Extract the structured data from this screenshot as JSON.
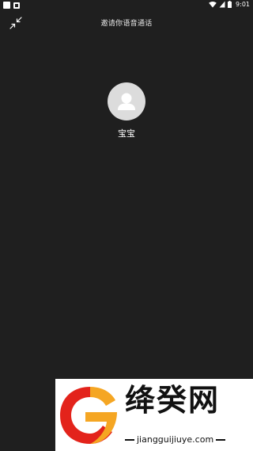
{
  "status_bar": {
    "time": "9:01",
    "icons": [
      "notification-square-icon",
      "app-notification-icon",
      "wifi-icon",
      "no-sim-icon",
      "battery-icon"
    ]
  },
  "call": {
    "title": "邀请你语音通话",
    "contact_name": "宝宝"
  },
  "controls": {
    "minimize_icon": "minimize-arrows-icon"
  },
  "watermark": {
    "title": "绛癸网",
    "url": "jiangguijiuye.com",
    "colors": {
      "red": "#e3231b",
      "orange": "#f5a623",
      "text": "#111111"
    }
  },
  "colors": {
    "background": "#1f1f1f",
    "avatar_bg": "#dcdcdc",
    "avatar_silhouette": "#ffffff"
  }
}
